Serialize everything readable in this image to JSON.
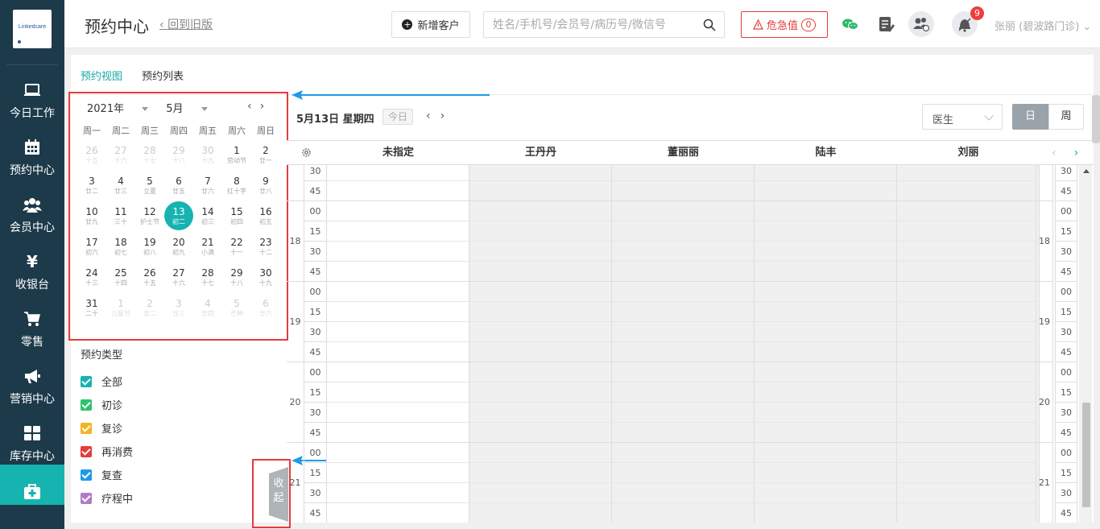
{
  "app": {
    "logo_text": "Linkedcare",
    "title": "预约中心",
    "back_link": "回到旧版"
  },
  "sidebar": {
    "items": [
      {
        "label": "今日工作",
        "icon": "laptop-icon"
      },
      {
        "label": "预约中心",
        "icon": "calendar-icon"
      },
      {
        "label": "会员中心",
        "icon": "members-icon"
      },
      {
        "label": "收银台",
        "icon": "yen-icon"
      },
      {
        "label": "零售",
        "icon": "cart-icon"
      },
      {
        "label": "营销中心",
        "icon": "megaphone-icon"
      },
      {
        "label": "库存中心",
        "icon": "grid-icon"
      },
      {
        "label": "",
        "icon": "medkit-icon"
      }
    ]
  },
  "header": {
    "new_customer": "新增客户",
    "search_placeholder": "姓名/手机号/会员号/病历号/微信号",
    "danger_label": "危急值",
    "danger_count": "0",
    "notification_count": "9",
    "user": "张丽 (碧波路门诊)"
  },
  "tabs": [
    "预约视图",
    "预约列表"
  ],
  "calendar": {
    "year": "2021年",
    "month": "5月",
    "weekdays": [
      "周一",
      "周二",
      "周三",
      "周四",
      "周五",
      "周六",
      "周日"
    ],
    "weeks": [
      [
        {
          "n": "26",
          "s": "十五",
          "off": true
        },
        {
          "n": "27",
          "s": "十六",
          "off": true
        },
        {
          "n": "28",
          "s": "十七",
          "off": true
        },
        {
          "n": "29",
          "s": "十八",
          "off": true
        },
        {
          "n": "30",
          "s": "十九",
          "off": true
        },
        {
          "n": "1",
          "s": "劳动节"
        },
        {
          "n": "2",
          "s": "廿一"
        }
      ],
      [
        {
          "n": "3",
          "s": "廿二"
        },
        {
          "n": "4",
          "s": "廿三"
        },
        {
          "n": "5",
          "s": "立夏"
        },
        {
          "n": "6",
          "s": "廿五"
        },
        {
          "n": "7",
          "s": "廿六"
        },
        {
          "n": "8",
          "s": "红十字"
        },
        {
          "n": "9",
          "s": "廿八"
        }
      ],
      [
        {
          "n": "10",
          "s": "廿九"
        },
        {
          "n": "11",
          "s": "三十"
        },
        {
          "n": "12",
          "s": "护士节"
        },
        {
          "n": "13",
          "s": "初二",
          "today": true
        },
        {
          "n": "14",
          "s": "初三"
        },
        {
          "n": "15",
          "s": "初四"
        },
        {
          "n": "16",
          "s": "初五"
        }
      ],
      [
        {
          "n": "17",
          "s": "初六"
        },
        {
          "n": "18",
          "s": "初七"
        },
        {
          "n": "19",
          "s": "初八"
        },
        {
          "n": "20",
          "s": "初九"
        },
        {
          "n": "21",
          "s": "小满"
        },
        {
          "n": "22",
          "s": "十一"
        },
        {
          "n": "23",
          "s": "十二"
        }
      ],
      [
        {
          "n": "24",
          "s": "十三"
        },
        {
          "n": "25",
          "s": "十四"
        },
        {
          "n": "26",
          "s": "十五"
        },
        {
          "n": "27",
          "s": "十六"
        },
        {
          "n": "28",
          "s": "十七"
        },
        {
          "n": "29",
          "s": "十八"
        },
        {
          "n": "30",
          "s": "十九"
        }
      ],
      [
        {
          "n": "31",
          "s": "二十"
        },
        {
          "n": "1",
          "s": "儿童节",
          "off": true
        },
        {
          "n": "2",
          "s": "廿二",
          "off": true
        },
        {
          "n": "3",
          "s": "廿三",
          "off": true
        },
        {
          "n": "4",
          "s": "廿四",
          "off": true
        },
        {
          "n": "5",
          "s": "芒种",
          "off": true
        },
        {
          "n": "6",
          "s": "廿六",
          "off": true
        }
      ]
    ]
  },
  "types": {
    "title": "预约类型",
    "items": [
      {
        "label": "全部",
        "color": "#17b3b0"
      },
      {
        "label": "初诊",
        "color": "#2ec36f"
      },
      {
        "label": "复诊",
        "color": "#f5b31e"
      },
      {
        "label": "再消费",
        "color": "#e53b3b"
      },
      {
        "label": "复查",
        "color": "#1e9be8"
      },
      {
        "label": "疗程中",
        "color": "#b07cc6"
      }
    ]
  },
  "collapse_label": "收起",
  "schedule": {
    "date": "5月13日 星期四",
    "today_button": "今日",
    "view_select": "医生",
    "day_button": "日",
    "week_button": "周",
    "columns": [
      "未指定",
      "王丹丹",
      "董丽丽",
      "陆丰",
      "刘丽"
    ],
    "slots": [
      {
        "hour": "",
        "min": "30"
      },
      {
        "hour": "",
        "min": "45"
      },
      {
        "hour": "18",
        "min": "00"
      },
      {
        "hour": "",
        "min": "15"
      },
      {
        "hour": "",
        "min": "30"
      },
      {
        "hour": "",
        "min": "45"
      },
      {
        "hour": "19",
        "min": "00"
      },
      {
        "hour": "",
        "min": "15"
      },
      {
        "hour": "",
        "min": "30"
      },
      {
        "hour": "",
        "min": "45"
      },
      {
        "hour": "20",
        "min": "00"
      },
      {
        "hour": "",
        "min": "15"
      },
      {
        "hour": "",
        "min": "30"
      },
      {
        "hour": "",
        "min": "45"
      },
      {
        "hour": "21",
        "min": "00"
      },
      {
        "hour": "",
        "min": "15"
      },
      {
        "hour": "",
        "min": "30"
      },
      {
        "hour": "",
        "min": "45"
      }
    ]
  },
  "colors": {
    "accent": "#17b3b0",
    "sidebar": "#1d3a4a",
    "alert": "#e53b3b",
    "arrow": "#1e9be8"
  }
}
